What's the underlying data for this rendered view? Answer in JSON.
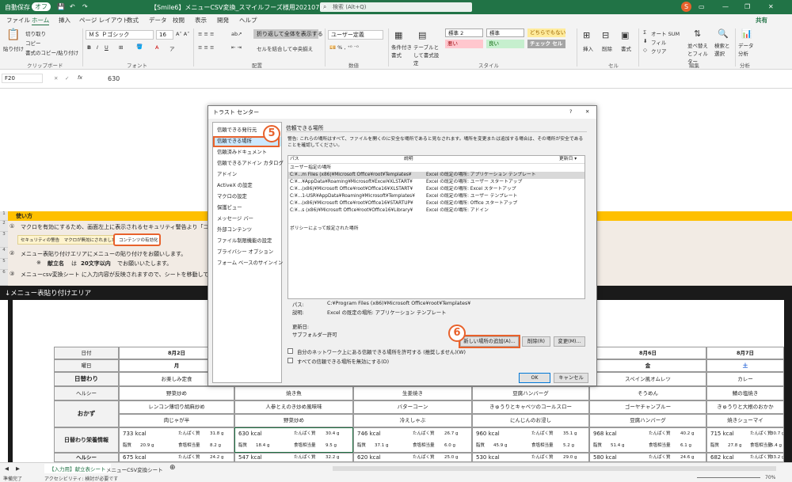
{
  "titlebar": {
    "autosave_label": "自動保存",
    "autosave_state": "オフ",
    "file_name": "【Smile6】メニューCSV変換_スマイルフーズ様用20210702 .xlsm",
    "search_placeholder": "検索 (Alt+Q)",
    "user_initial": "S"
  },
  "tabs": [
    "ファイル",
    "ホーム",
    "挿入",
    "ページ レイアウト",
    "数式",
    "データ",
    "校閲",
    "表示",
    "開発",
    "ヘルプ"
  ],
  "share_label": "共有",
  "ribbon": {
    "paste": "貼り付け",
    "cut": "切り取り",
    "copy": "コピー",
    "format_painter": "書式のコピー/貼り付け",
    "clipboard_group": "クリップボード",
    "font_name": "ＭＳ Ｐゴシック",
    "font_size": "16",
    "font_group": "フォント",
    "wrap_text": "折り返して全体を表示する",
    "merge_center": "セルを結合して中央揃え",
    "alignment_group": "配置",
    "number_format": "ユーザー定義",
    "number_group": "数値",
    "conditional_format": "条件付き書式",
    "format_as_table": "テーブルとして書式設定",
    "styles": [
      {
        "label": "標準 2",
        "bg": "#ffffff",
        "fg": "#222222"
      },
      {
        "label": "標準",
        "bg": "#ffffff",
        "fg": "#222222"
      },
      {
        "label": "どちらでもない",
        "bg": "#ffeb9c",
        "fg": "#9c6500"
      },
      {
        "label": "悪い",
        "bg": "#ffc7ce",
        "fg": "#9c0006"
      },
      {
        "label": "良い",
        "bg": "#c6efce",
        "fg": "#006100"
      },
      {
        "label": "チェック セル",
        "bg": "#a5a5a5",
        "fg": "#ffffff"
      }
    ],
    "styles_group": "スタイル",
    "insert": "挿入",
    "delete": "削除",
    "format": "書式",
    "cells_group": "セル",
    "autosum": "オート SUM",
    "fill": "フィル",
    "clear": "クリア",
    "sort_filter": "並べ替えとフィルター",
    "find_select": "検索と選択",
    "editing_group": "編集",
    "analyze_data": "データ分析",
    "analysis_group": "分析"
  },
  "formula_bar": {
    "name_box": "F20",
    "fx": "fx",
    "value": "630"
  },
  "sheet": {
    "header_band": "使い方",
    "step1": "マクロを有効にするため、画面左上に表示されるセキュリティ警告より「コンテンツ",
    "security_warning": "セキュリティの警告　マクロが無効にされました。",
    "enable_content": "コンテンツの有効化",
    "step2": "メニュー表貼り付けエリアにメニューの貼り付けをお願いします。",
    "step2_note_prefix": "※",
    "step2_note_bold1": "献立名",
    "step2_note_mid": "は",
    "step2_note_bold2": "20文字以内",
    "step2_note_suffix": "でお願いいたします。",
    "step3": "メニューcsv変換シート に入力内容が反映されますので、シートを移動してくだ",
    "circled": [
      "①",
      "②",
      "③"
    ],
    "paste_area": "↓メニュー表貼り付けエリア",
    "row_labels": [
      "日付",
      "曜日",
      "日替わり",
      "ヘルシー",
      "おかず",
      "日替わり栄養情報",
      "ヘルシー"
    ],
    "day_headers": [
      "8月2日",
      "8月6日",
      "8月7日"
    ],
    "weekdays": [
      "月",
      "金",
      "土"
    ],
    "menu_rows": [
      [
        "お楽しみ定食",
        "",
        "",
        "",
        "スペイン風オムレツ",
        "カレー"
      ],
      [
        "野菜炒め",
        "焼き魚",
        "生姜焼き",
        "豆腐ハンバーグ",
        "そうめん",
        "鯖の塩焼き"
      ],
      [
        "レンコン薄切り胡麻炒め",
        "人参とえのき炒め風味味",
        "バターコーン",
        "きゅうりとキャベツのコールスロー",
        "ゴーヤチャンプルー",
        "きゅうりと大根のおかか"
      ],
      [
        "肉じゃが半",
        "野菜炒め",
        "冷えしゃぶ",
        "にんじんのお浸し",
        "豆腐ハンバーグ",
        "焼きシューマイ"
      ]
    ],
    "nutrition": {
      "kcal": [
        "733 kcal",
        "630 kcal",
        "746 kcal",
        "960 kcal",
        "968 kcal",
        "715 kcal"
      ],
      "protein_label": "たんぱく質",
      "protein": [
        "31.8 g",
        "30.4 g",
        "26.7 g",
        "35.1 g",
        "40.2 g",
        "30.7 g"
      ],
      "fat_label": "脂質",
      "fat": [
        "20.9 g",
        "18.4 g",
        "37.1 g",
        "45.9 g",
        "51.4 g",
        "27.8 g"
      ],
      "salt_label": "食塩相当量",
      "salt": [
        "8.2 g",
        "9.5 g",
        "6.0 g",
        "5.2 g",
        "6.1 g",
        "5.4 g"
      ],
      "kcal2": [
        "675 kcal",
        "547 kcal",
        "620 kcal",
        "530 kcal",
        "580 kcal",
        "682 kcal"
      ],
      "protein2": [
        "24.2 g",
        "32.2 g",
        "25.0 g",
        "29.0 g",
        "24.6 g",
        "33.2 g"
      ]
    }
  },
  "dialog": {
    "title": "トラスト センター",
    "help": "?",
    "close": "✕",
    "nav": [
      "信頼できる発行元",
      "信頼できる場所",
      "信頼済みドキュメント",
      "信頼できるアドイン カタログ",
      "アドイン",
      "ActiveX の設定",
      "マクロの設定",
      "保護ビュー",
      "メッセージ バー",
      "外部コンテンツ",
      "ファイル制限機能の設定",
      "プライバシー オプション",
      "フォーム ベースのサインイン"
    ],
    "section_title": "信頼できる場所",
    "warning": "警告: これらの場所はすべて、ファイルを開くのに安全な場所であると見なされます。場所を変更または追加する場合は、その場所が安全であることを確認してください。",
    "col_path": "パス",
    "col_desc": "説明",
    "col_date": "更新日 ▾",
    "user_group": "ユーザー指定の場所",
    "locations": [
      {
        "path": "C:¥...m Files (x86)¥Microsoft Office¥root¥Templates¥",
        "desc": "Excel の既定の場所: アプリケーション テンプレート"
      },
      {
        "path": "C:¥...¥AppData¥Roaming¥Microsoft¥Excel¥XLSTART¥",
        "desc": "Excel の既定の場所: ユーザー スタートアップ"
      },
      {
        "path": "C:¥...(x86)¥Microsoft Office¥root¥Office16¥XLSTART¥",
        "desc": "Excel の既定の場所: Excel スタートアップ"
      },
      {
        "path": "C:¥...1-USR¥AppData¥Roaming¥Microsoft¥Templates¥",
        "desc": "Excel の既定の場所: ユーザー テンプレート"
      },
      {
        "path": "C:¥...(x86)¥Microsoft Office¥root¥Office16¥STARTUP¥",
        "desc": "Excel の既定の場所: Office スタートアップ"
      },
      {
        "path": "C:¥...s (x86)¥Microsoft Office¥root¥Office16¥Library¥",
        "desc": "Excel の既定の場所: アドイン"
      }
    ],
    "policy_group": "ポリシーによって設定された場所",
    "path_label": "パス:",
    "path_value": "C:¥Program Files (x86)¥Microsoft Office¥root¥Templates¥",
    "desc_label": "説明:",
    "desc_value": "Excel の既定の場所: アプリケーション テンプレート",
    "date_label": "更新日:",
    "subfolder_label": "サブフォルダー:",
    "subfolder_value": "許可",
    "add_button": "新しい場所の追加(A)...",
    "remove_button": "削除(R)",
    "modify_button": "変更(M)...",
    "allow_network": "自分のネットワーク上にある信頼できる場所を許可する (推奨しません)(W)",
    "disable_all": "すべての信頼できる場所を無効にする(D)",
    "ok": "OK",
    "cancel": "キャンセル"
  },
  "badges": [
    "5",
    "6"
  ],
  "sheet_tabs": [
    "【入力用】献立表シート",
    "メニューCSV変換シート"
  ],
  "status": {
    "ready": "準備完了",
    "accessibility": "アクセシビリティ: 検討が必要です",
    "zoom": "70%"
  },
  "colors": {
    "excel_green": "#217346",
    "band_yellow": "#ffc000",
    "paste_bar": "#1a1a1a",
    "accent_orange": "#e8622c"
  }
}
